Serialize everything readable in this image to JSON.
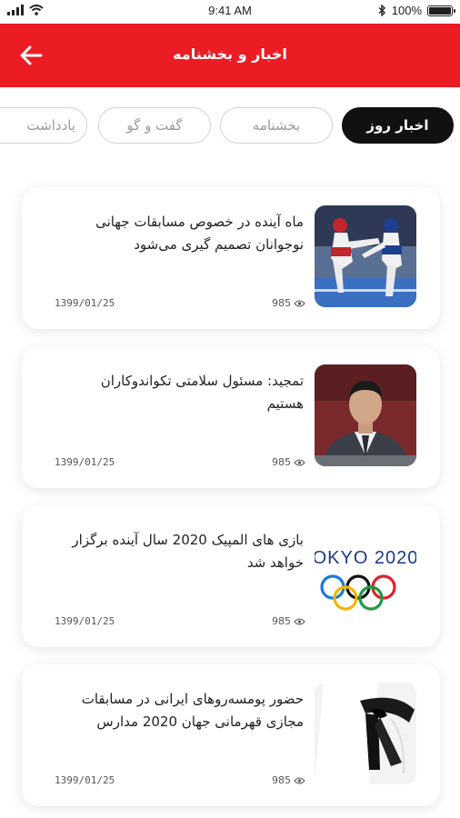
{
  "status_bar": {
    "time": "9:41 AM",
    "battery": "100%"
  },
  "header": {
    "title": "اخبار و بخشنامه"
  },
  "tabs": [
    {
      "label": "اخبار روز",
      "active": true
    },
    {
      "label": "بخشنامه",
      "active": false
    },
    {
      "label": "گفت و گو",
      "active": false
    },
    {
      "label": "یادداشت",
      "active": false
    }
  ],
  "news": [
    {
      "title": "ماه آینده در خصوص مسابقات جهانی نوجوانان تصمیم گیری می‌شود",
      "views": "985",
      "date": "1399/01/25",
      "image": "taekwondo-kick-photo"
    },
    {
      "title": "تمجید: مسئول سلامتی تکواندوکاران هستیم",
      "views": "985",
      "date": "1399/01/25",
      "image": "man-portrait-photo"
    },
    {
      "title": "بازی های المپیک 2020 سال آینده برگزار خواهد شد",
      "views": "985",
      "date": "1399/01/25",
      "image": "tokyo-2020-olympics-logo",
      "logo_text": "OKYO 2020"
    },
    {
      "title": "حضور پومسه‌روهای ایرانی در مسابقات مجازی قهرمانی جهان 2020 مدارس",
      "views": "985",
      "date": "1399/01/25",
      "image": "black-belt-photo"
    }
  ],
  "colors": {
    "header": "#ec1c24",
    "tab_active": "#111111",
    "tab_border": "#d3d3d3"
  }
}
